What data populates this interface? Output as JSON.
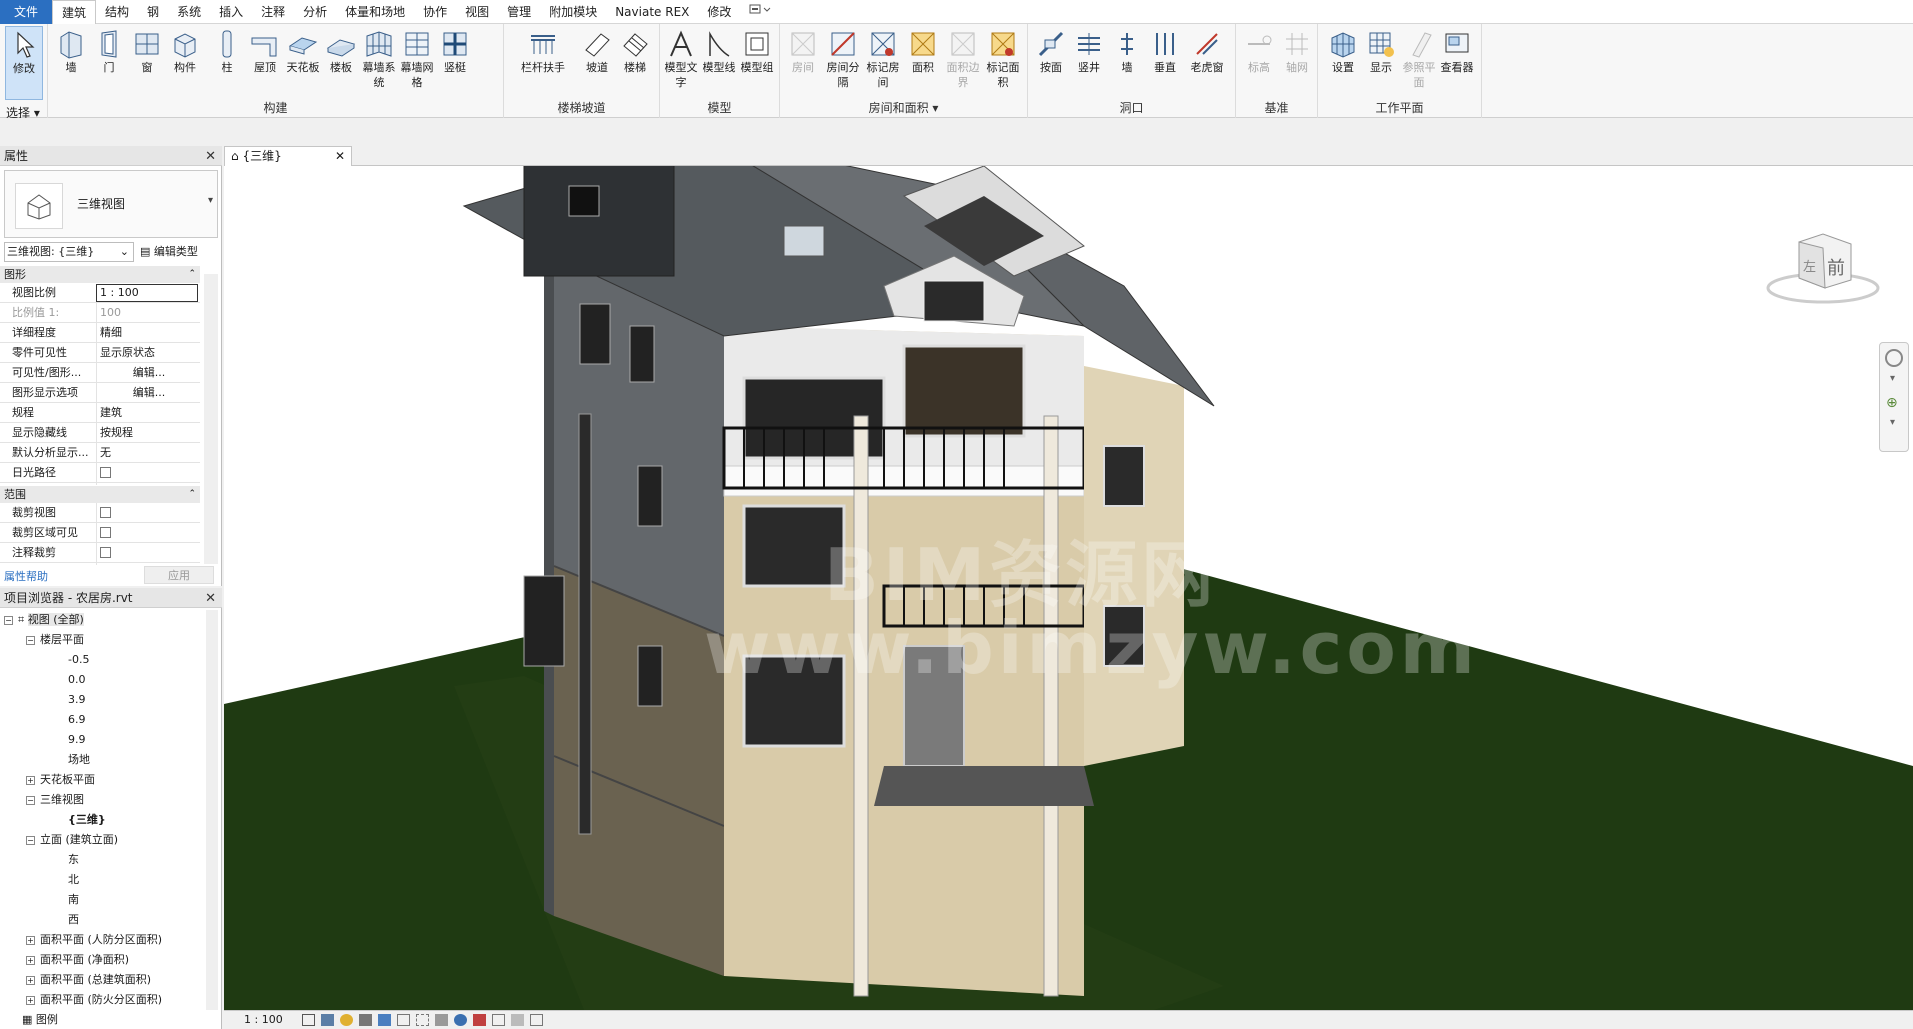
{
  "menu": {
    "file": "文件",
    "tabs": [
      "建筑",
      "结构",
      "钢",
      "系统",
      "插入",
      "注释",
      "分析",
      "体量和场地",
      "协作",
      "视图",
      "管理",
      "附加模块",
      "Naviate REX",
      "修改"
    ],
    "active_tab": "建筑"
  },
  "ribbon": {
    "select": {
      "modify": "修改",
      "dropdown": "选择"
    },
    "build": {
      "label": "构建",
      "buttons": [
        "墙",
        "门",
        "窗",
        "构件",
        "柱",
        "屋顶",
        "天花板",
        "楼板",
        "幕墙系统",
        "幕墙网格",
        "竖梃"
      ]
    },
    "stairs": {
      "label": "楼梯坡道",
      "buttons": [
        "栏杆扶手",
        "坡道",
        "楼梯"
      ]
    },
    "model": {
      "label": "模型",
      "buttons": [
        "模型文字",
        "模型线",
        "模型组"
      ]
    },
    "room_area": {
      "label": "房间和面积",
      "buttons": [
        "房间",
        "房间分隔",
        "标记房间",
        "面积",
        "面积边界",
        "标记面积"
      ]
    },
    "opening": {
      "label": "洞口",
      "buttons": [
        "按面",
        "竖井",
        "墙",
        "垂直",
        "老虎窗"
      ]
    },
    "datum": {
      "label": "基准",
      "buttons": [
        "标高",
        "轴网"
      ]
    },
    "workplane": {
      "label": "工作平面",
      "buttons": [
        "设置",
        "显示",
        "参照平面",
        "查看器"
      ]
    }
  },
  "properties": {
    "title": "属性",
    "type_name": "三维视图",
    "view_selector": "三维视图: {三维}",
    "edit_type": "编辑类型",
    "sections": {
      "graphics": "图形",
      "extents": "范围"
    },
    "rows": [
      {
        "k": "视图比例",
        "v": "1 : 100"
      },
      {
        "k": "比例值 1:",
        "v": "100"
      },
      {
        "k": "详细程度",
        "v": "精细"
      },
      {
        "k": "零件可见性",
        "v": "显示原状态"
      },
      {
        "k": "可见性/图形...",
        "v": "编辑..."
      },
      {
        "k": "图形显示选项",
        "v": "编辑..."
      },
      {
        "k": "规程",
        "v": "建筑"
      },
      {
        "k": "显示隐藏线",
        "v": "按规程"
      },
      {
        "k": "默认分析显示...",
        "v": "无"
      },
      {
        "k": "日光路径",
        "v": ""
      }
    ],
    "extent_rows": [
      {
        "k": "裁剪视图"
      },
      {
        "k": "裁剪区域可见"
      },
      {
        "k": "注释裁剪"
      }
    ],
    "help": "属性帮助",
    "apply": "应用"
  },
  "browser": {
    "title": "项目浏览器 - 农居房.rvt",
    "views_all": "视图 (全部)",
    "floor_plans": "楼层平面",
    "levels": [
      "-0.5",
      "0.0",
      "3.9",
      "6.9",
      "9.9",
      "场地"
    ],
    "ceiling_plans": "天花板平面",
    "views_3d": "三维视图",
    "view_3d_item": "{三维}",
    "elevations": "立面 (建筑立面)",
    "elevation_items": [
      "东",
      "北",
      "南",
      "西"
    ],
    "area_plans": [
      "面积平面 (人防分区面积)",
      "面积平面 (净面积)",
      "面积平面 (总建筑面积)",
      "面积平面 (防火分区面积)"
    ],
    "legends": "图例"
  },
  "viewport": {
    "tab_label": "{三维}",
    "viewcube_front": "前",
    "viewcube_left": "左",
    "watermark_line1": "BIM资源网",
    "watermark_line2": "www.bimzyw.com"
  },
  "status": {
    "scale": "1 : 100"
  }
}
